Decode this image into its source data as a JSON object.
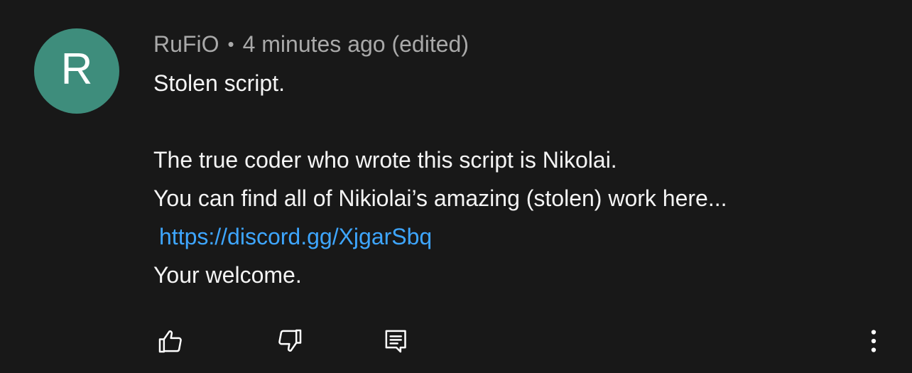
{
  "comment": {
    "avatar_letter": "R",
    "avatar_color": "#3e8d7c",
    "author": "RuFiO",
    "separator": "•",
    "timestamp": "4 minutes ago (edited)",
    "lines": [
      "Stolen script.",
      "",
      "The true  coder who wrote this script is Nikolai.",
      "You can find all of Nikiolai’s amazing (stolen) work here...",
      "https://discord.gg/XjgarSbq",
      "Your welcome."
    ],
    "link_color": "#3ea6ff"
  },
  "actions": {
    "like_icon": "thumbs-up-icon",
    "dislike_icon": "thumbs-down-icon",
    "reply_icon": "reply-comment-icon",
    "more_icon": "more-vertical-icon"
  }
}
